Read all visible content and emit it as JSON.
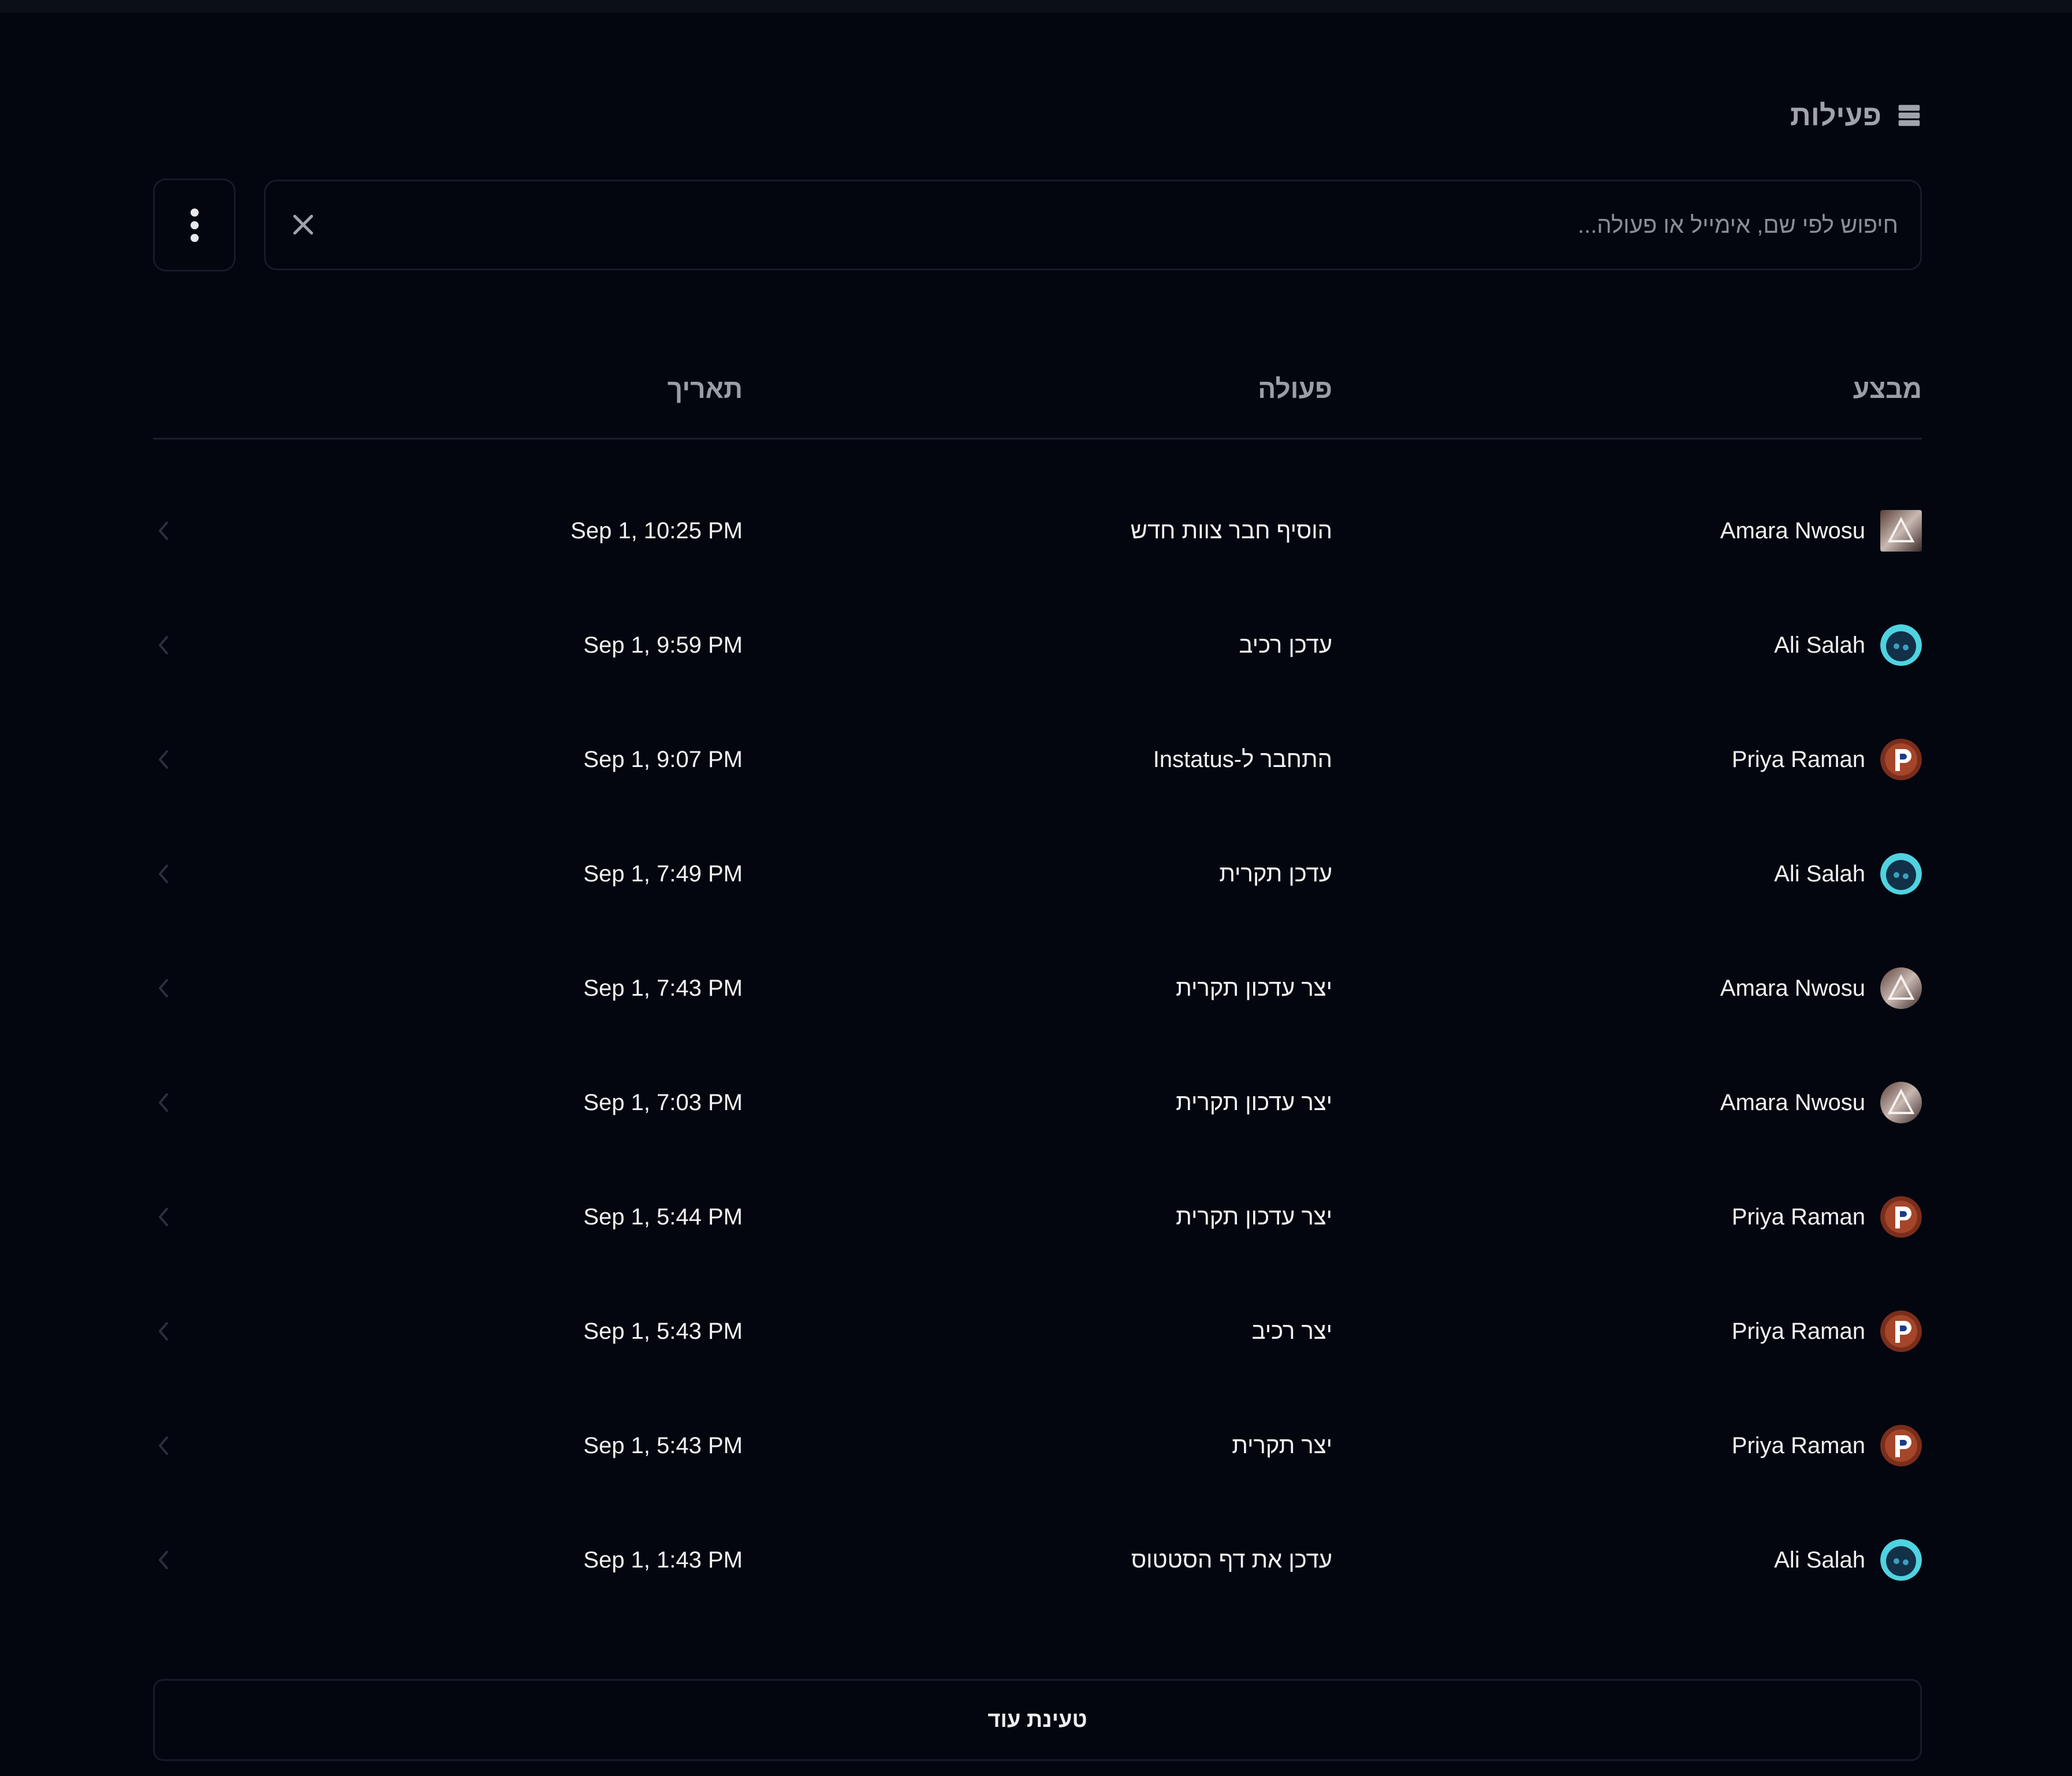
{
  "header": {
    "title": "פעילות",
    "icon": "database-icon"
  },
  "search": {
    "placeholder": "חיפוש לפי שם, אימייל או פעולה...",
    "value": ""
  },
  "table": {
    "columns": {
      "user": "מבצע",
      "action": "פעולה",
      "date": "תאריך"
    },
    "rows": [
      {
        "user": "Amara Nwosu",
        "avatar": "amara",
        "action": "הוסיף חבר צוות חדש",
        "date": "Sep 1, 10:25 PM"
      },
      {
        "user": "Ali Salah",
        "avatar": "ali",
        "action": "עדכן רכיב",
        "date": "Sep 1, 9:59 PM"
      },
      {
        "user": "Priya Raman",
        "avatar": "priya",
        "action": "התחבר ל-Instatus",
        "date": "Sep 1, 9:07 PM"
      },
      {
        "user": "Ali Salah",
        "avatar": "ali",
        "action": "עדכן תקרית",
        "date": "Sep 1, 7:49 PM"
      },
      {
        "user": "Amara Nwosu",
        "avatar": "amara",
        "action": "יצר עדכון תקרית",
        "date": "Sep 1, 7:43 PM"
      },
      {
        "user": "Amara Nwosu",
        "avatar": "amara",
        "action": "יצר עדכון תקרית",
        "date": "Sep 1, 7:03 PM"
      },
      {
        "user": "Priya Raman",
        "avatar": "priya",
        "action": "יצר עדכון תקרית",
        "date": "Sep 1, 5:44 PM"
      },
      {
        "user": "Priya Raman",
        "avatar": "priya",
        "action": "יצר רכיב",
        "date": "Sep 1, 5:43 PM"
      },
      {
        "user": "Priya Raman",
        "avatar": "priya",
        "action": "יצר תקרית",
        "date": "Sep 1, 5:43 PM"
      },
      {
        "user": "Ali Salah",
        "avatar": "ali",
        "action": "עדכן את דף הסטטוס",
        "date": "Sep 1, 1:43 PM"
      }
    ]
  },
  "load_more": {
    "label": "טעינת עוד"
  },
  "colors": {
    "background": "#03060f",
    "border": "#161b26",
    "text": "#f2f3f5",
    "muted": "#9a9ea7"
  }
}
